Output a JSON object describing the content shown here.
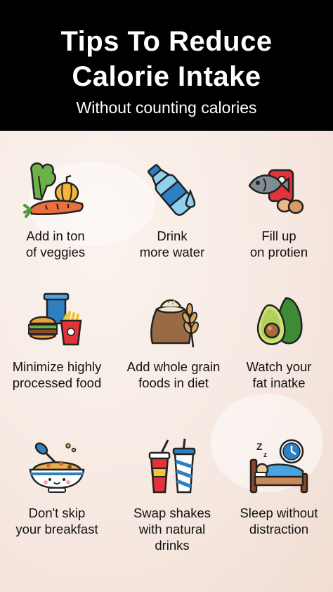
{
  "header": {
    "title_line1": "Tips To Reduce",
    "title_line2": "Calorie Intake",
    "subtitle": "Without counting calories"
  },
  "tips": [
    {
      "icon": "vegetables-icon",
      "lines": [
        "Add in ton",
        "of veggies"
      ]
    },
    {
      "icon": "water-bottle-icon",
      "lines": [
        "Drink",
        "more water"
      ]
    },
    {
      "icon": "protein-icon",
      "lines": [
        "Fill up",
        "on protien"
      ]
    },
    {
      "icon": "fast-food-icon",
      "lines": [
        "Minimize highly",
        "processed food"
      ]
    },
    {
      "icon": "whole-grain-icon",
      "lines": [
        "Add whole grain",
        "foods in diet"
      ]
    },
    {
      "icon": "avocado-icon",
      "lines": [
        "Watch your",
        "fat inatke"
      ]
    },
    {
      "icon": "breakfast-bowl-icon",
      "lines": [
        "Don't skip",
        "your breakfast"
      ]
    },
    {
      "icon": "drinks-icon",
      "lines": [
        "Swap shakes",
        "with natural",
        "drinks"
      ]
    },
    {
      "icon": "sleep-icon",
      "lines": [
        "Sleep without",
        "distraction"
      ]
    }
  ]
}
